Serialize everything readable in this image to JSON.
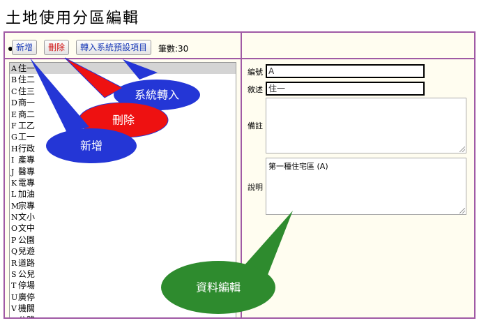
{
  "page": {
    "title": "土地使用分區編輯"
  },
  "toolbar": {
    "add_label": "新增",
    "delete_label": "刪除",
    "import_label": "轉入系統預設項目",
    "count_label": "筆數:30"
  },
  "list": {
    "items": [
      {
        "code": "A",
        "name": "住一"
      },
      {
        "code": "B",
        "name": "住二"
      },
      {
        "code": "C",
        "name": "住三"
      },
      {
        "code": "D",
        "name": "商一"
      },
      {
        "code": "E",
        "name": "商二"
      },
      {
        "code": "F",
        "name": "工乙"
      },
      {
        "code": "G",
        "name": "工一"
      },
      {
        "code": "H",
        "name": "行政"
      },
      {
        "code": "I",
        "name": "產專"
      },
      {
        "code": "J",
        "name": "醫專"
      },
      {
        "code": "K",
        "name": "電專"
      },
      {
        "code": "L",
        "name": "加油"
      },
      {
        "code": "M",
        "name": "宗專"
      },
      {
        "code": "N",
        "name": "文小"
      },
      {
        "code": "O",
        "name": "文中"
      },
      {
        "code": "P",
        "name": "公園"
      },
      {
        "code": "Q",
        "name": "兒遊"
      },
      {
        "code": "R",
        "name": "道路"
      },
      {
        "code": "S",
        "name": "公兒"
      },
      {
        "code": "T",
        "name": "停場"
      },
      {
        "code": "U",
        "name": "廣停"
      },
      {
        "code": "V",
        "name": "機關"
      },
      {
        "code": "W",
        "name": "公體"
      }
    ]
  },
  "form": {
    "code_label": "編號",
    "code_value": "A",
    "desc_label": "敘述",
    "desc_value": "住一",
    "note_label": "備註",
    "note_value": "",
    "explain_label": "說明",
    "explain_value": "第一種住宅區 (A)"
  },
  "callouts": {
    "system_import": "系統轉入",
    "delete": "刪除",
    "add": "新增",
    "data_edit": "資料編輯"
  },
  "colors": {
    "frame_border": "#a05aa5",
    "panel_bg": "#fffdf0",
    "callout_blue": "#2436d6",
    "callout_red": "#ee1111",
    "callout_green": "#2e8b2e"
  }
}
